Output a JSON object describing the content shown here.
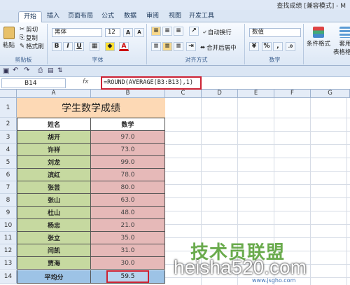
{
  "app": {
    "title": "查找成绩 [兼容模式] - M"
  },
  "tabs": [
    "开始",
    "插入",
    "页面布局",
    "公式",
    "数据",
    "审阅",
    "视图",
    "开发工具"
  ],
  "ribbon": {
    "clipboard": {
      "paste": "粘贴",
      "cut": "剪切",
      "copy": "复制",
      "format_painter": "格式刷",
      "label": "剪贴板"
    },
    "font": {
      "name": "黑体",
      "size": "12",
      "bold": "B",
      "italic": "I",
      "underline": "U",
      "label": "字体"
    },
    "alignment": {
      "wrap": "自动换行",
      "merge": "合并后居中",
      "label": "对齐方式"
    },
    "number": {
      "format": "数值",
      "percent": "%",
      "comma": ",",
      "label": "数字"
    },
    "styles": {
      "conditional": "条件格式",
      "table": "套用\n表格格式"
    }
  },
  "formula_bar": {
    "name_box": "B14",
    "fx": "fx",
    "formula": "=ROUND(AVERAGE(B3:B13),1)"
  },
  "columns": [
    "A",
    "B",
    "C",
    "D",
    "E",
    "F",
    "G"
  ],
  "sheet": {
    "title": "学生数学成绩",
    "header_name": "姓名",
    "header_score": "数学",
    "rows": [
      {
        "row": "3",
        "name": "胡开",
        "score": "97.0"
      },
      {
        "row": "4",
        "name": "许祥",
        "score": "73.0"
      },
      {
        "row": "5",
        "name": "刘龙",
        "score": "99.0"
      },
      {
        "row": "6",
        "name": "滨红",
        "score": "78.0"
      },
      {
        "row": "7",
        "name": "张芸",
        "score": "80.0"
      },
      {
        "row": "8",
        "name": "张山",
        "score": "63.0"
      },
      {
        "row": "9",
        "name": "杜山",
        "score": "48.0"
      },
      {
        "row": "10",
        "name": "杨忠",
        "score": "21.0"
      },
      {
        "row": "11",
        "name": "张立",
        "score": "35.0"
      },
      {
        "row": "12",
        "name": "闫凯",
        "score": "31.0"
      },
      {
        "row": "13",
        "name": "贾海",
        "score": "30.0"
      }
    ],
    "avg_row": "14",
    "avg_label": "平均分",
    "avg_value": "59.5"
  },
  "watermark": {
    "cn": "技术员联盟",
    "site": "heisha520.com",
    "url": "www.jsgho.com"
  },
  "colors": {
    "title_fill": "#fdd9b5",
    "name_fill": "#c6d9a0",
    "score_fill": "#e6b9b8",
    "avg_fill": "#9dc3e6",
    "highlight": "#cc2233"
  }
}
